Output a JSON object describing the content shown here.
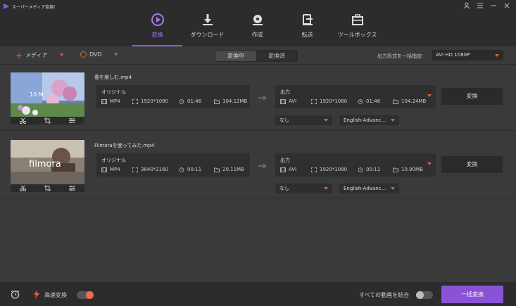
{
  "app": {
    "title": "スーパーメディア変換！",
    "accent": "#8b5bd9",
    "window_controls": [
      "user-icon",
      "menu-icon",
      "minimize-icon",
      "close-icon"
    ]
  },
  "nav": {
    "tabs": [
      {
        "label": "変換",
        "icon": "convert-icon",
        "active": true
      },
      {
        "label": "ダウンロード",
        "icon": "download-icon",
        "active": false
      },
      {
        "label": "作成",
        "icon": "burn-icon",
        "active": false
      },
      {
        "label": "転送",
        "icon": "transfer-icon",
        "active": false
      },
      {
        "label": "ツールボックス",
        "icon": "toolbox-icon",
        "active": false
      }
    ]
  },
  "toolbar": {
    "add_media_label": "メディア",
    "dvd_label": "DVD",
    "segment": {
      "converting": "変換中",
      "converted": "変換済",
      "selected": "変換中"
    },
    "bulk_format_label": "出力形式を一括指定:",
    "bulk_format_value": "AVI HD 1080P"
  },
  "files": [
    {
      "name": "春を楽しむ.mp4",
      "original": {
        "label": "オリジナル",
        "format": "MP4",
        "resolution": "1920*1080",
        "duration": "01:46",
        "size": "104.12MB"
      },
      "output": {
        "label": "出力",
        "format": "AVI",
        "resolution": "1920*1080",
        "duration": "01:46",
        "size": "104.24MB"
      },
      "subtitle": "なし",
      "audio": "English-Advanc...",
      "convert_label": "変換"
    },
    {
      "name": "Filmoraを使ってみた.mp4",
      "original": {
        "label": "オリジナル",
        "format": "MP4",
        "resolution": "3840*2160",
        "duration": "00:11",
        "size": "20.11MB"
      },
      "output": {
        "label": "出力",
        "format": "AVI",
        "resolution": "1920*1080",
        "duration": "00:11",
        "size": "10.90MB"
      },
      "subtitle": "なし",
      "audio": "English-Advanc...",
      "convert_label": "変換",
      "thumb_text": "filmora"
    }
  ],
  "bottom": {
    "high_speed_label": "高速変換",
    "high_speed_on": true,
    "merge_label": "すべての動画を結合",
    "merge_on": false,
    "bulk_convert_label": "一括変換"
  }
}
